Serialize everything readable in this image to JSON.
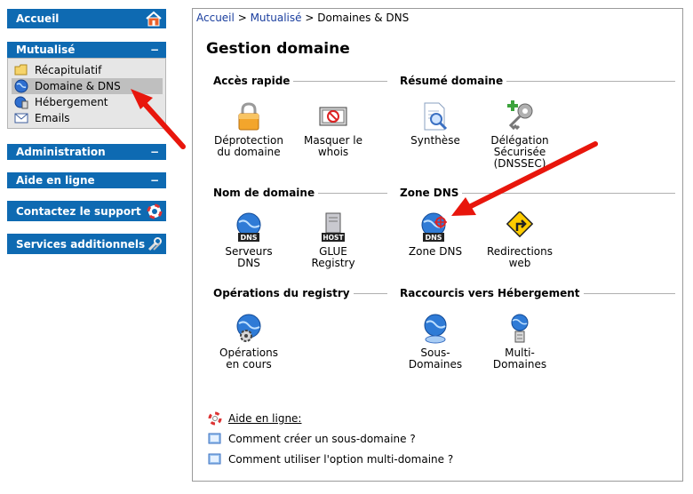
{
  "sidebar": {
    "accueil": "Accueil",
    "mutualise": {
      "label": "Mutualisé",
      "toggle": "−",
      "items": [
        {
          "label": "Récapitulatif",
          "icon": "folder-icon"
        },
        {
          "label": "Domaine & DNS",
          "icon": "globe-icon"
        },
        {
          "label": "Hébergement",
          "icon": "hosting-icon"
        },
        {
          "label": "Emails",
          "icon": "email-icon"
        }
      ]
    },
    "administration": {
      "label": "Administration",
      "toggle": "−"
    },
    "aide": {
      "label": "Aide en ligne",
      "toggle": "−"
    },
    "contact": "Contactez le support",
    "services": "Services additionnels"
  },
  "breadcrumb": {
    "home": "Accueil",
    "section": "Mutualisé",
    "sep": ">",
    "current": "Domaines & DNS"
  },
  "page_title": "Gestion domaine",
  "sections": {
    "acces_rapide": "Accès rapide",
    "resume_domaine": "Résumé domaine",
    "nom_domaine": "Nom de domaine",
    "zone_dns": "Zone DNS",
    "operations_registry": "Opérations du registry",
    "raccourcis": "Raccourcis vers Hébergement"
  },
  "tiles": {
    "deprotection": {
      "l1": "Déprotection",
      "l2": "du domaine"
    },
    "masquer": {
      "l1": "Masquer le",
      "l2": "whois"
    },
    "synthese": {
      "l1": "Synthèse"
    },
    "delegation": {
      "l1": "Délégation",
      "l2": "Sécurisée",
      "l3": "(DNSSEC)"
    },
    "serveurs": {
      "l1": "Serveurs",
      "l2": "DNS",
      "badge": "DNS"
    },
    "glue": {
      "l1": "GLUE",
      "l2": "Registry",
      "badge": "HOST"
    },
    "zone": {
      "l1": "Zone DNS",
      "badge": "DNS"
    },
    "redirections": {
      "l1": "Redirections",
      "l2": "web"
    },
    "operations": {
      "l1": "Opérations",
      "l2": "en cours"
    },
    "sous_domaines": {
      "l1": "Sous-",
      "l2": "Domaines"
    },
    "multi_domaines": {
      "l1": "Multi-",
      "l2": "Domaines"
    }
  },
  "help": {
    "title": "Aide en ligne:",
    "link1": "Comment créer un sous-domaine ?",
    "link2": "Comment utiliser l'option multi-domaine ?"
  },
  "colors": {
    "sidebar_blue": "#0e6ab2",
    "annotation_red": "#e8160c",
    "link_blue": "#1a3e9e"
  }
}
